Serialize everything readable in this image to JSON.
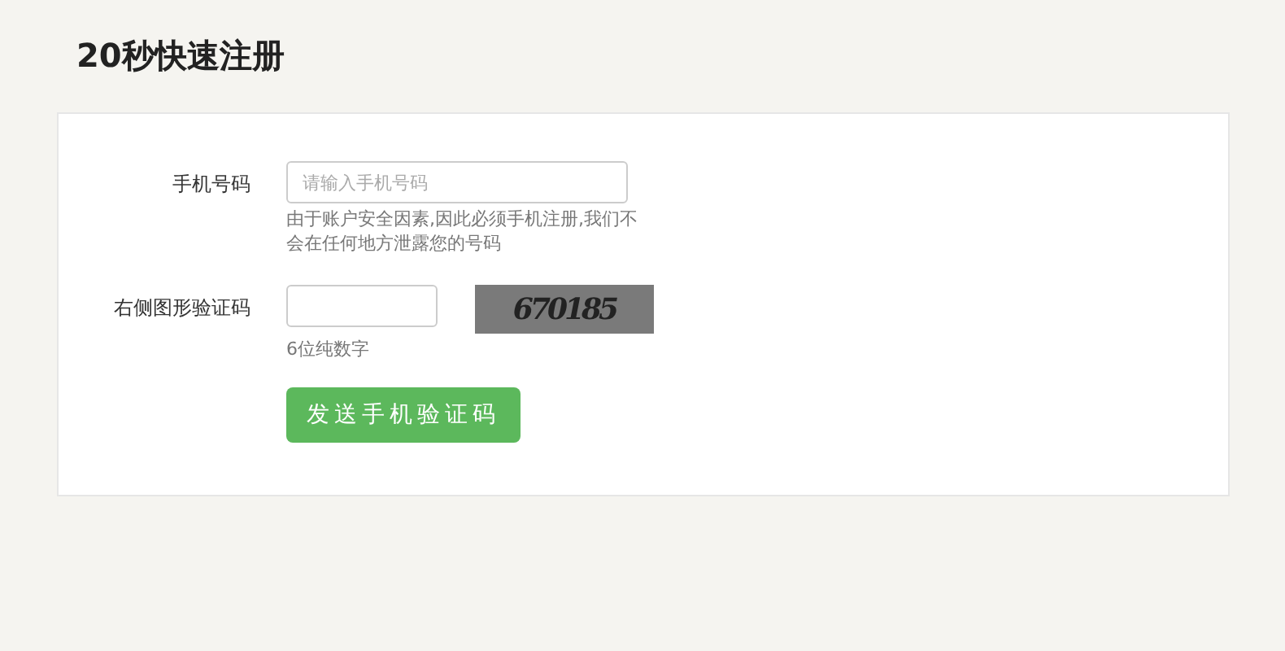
{
  "title": "20秒快速注册",
  "form": {
    "rows": [
      {
        "kind": "phone",
        "label": "手机号码",
        "placeholder": "请输入手机号码",
        "hint": "由于账户安全因素,因此必须手机注册,我们不会在任何地方泄露您的号码"
      },
      {
        "kind": "captcha",
        "label": "右侧图形验证码",
        "captcha": "670185",
        "hint": "6位纯数字"
      }
    ],
    "submit": "发送手机验证码"
  }
}
